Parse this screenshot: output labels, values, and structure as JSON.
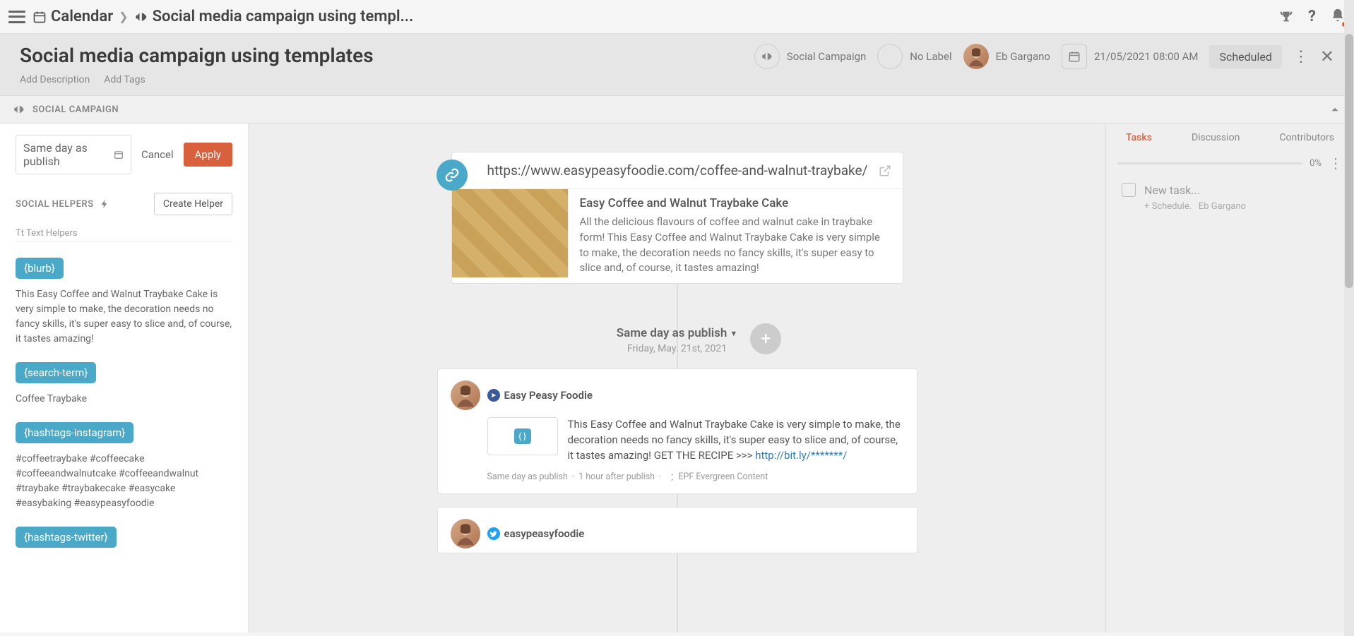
{
  "breadcrumb": {
    "root": "Calendar",
    "current": "Social media campaign using templ..."
  },
  "header": {
    "title": "Social media campaign using templates",
    "add_description": "Add Description",
    "add_tags": "Add Tags",
    "campaign_type": "Social Campaign",
    "label": "No Label",
    "owner": "Eb Gargano",
    "datetime": "21/05/2021 08:00 AM",
    "status": "Scheduled"
  },
  "section_bar": {
    "title": "SOCIAL CAMPAIGN"
  },
  "sidebar": {
    "date_placeholder": "Same day as publish",
    "cancel": "Cancel",
    "apply": "Apply",
    "helpers_title": "SOCIAL HELPERS",
    "create_helper": "Create Helper",
    "text_helpers_label": "Tt  Text Helpers",
    "helpers": [
      {
        "tag": "{blurb}",
        "text": "This Easy Coffee and Walnut Traybake Cake is very simple to make, the decoration needs no fancy skills, it's super easy to slice and, of course, it tastes amazing!"
      },
      {
        "tag": "{search-term}",
        "text": "Coffee Traybake"
      },
      {
        "tag": "{hashtags-instagram}",
        "text": "#coffeetraybake #coffeecake #coffeeandwalnutcake #coffeeandwalnut #traybake #traybakecake #easycake #easybaking #easypeasyfoodie"
      },
      {
        "tag": "{hashtags-twitter}",
        "text": ""
      }
    ]
  },
  "canvas": {
    "url": "https://www.easypeasyfoodie.com/coffee-and-walnut-traybake/",
    "url_title": "Easy Coffee and Walnut Traybake Cake",
    "url_desc": "All the delicious flavours of coffee and walnut cake in traybake form! This Easy Coffee and Walnut Traybake Cake is very simple to make, the decoration needs no fancy skills, it's super easy to slice and, of course, it tastes amazing!",
    "timeline_label": "Same day as publish",
    "timeline_date": "Friday, May. 21st, 2021",
    "posts": [
      {
        "network": "facebook",
        "handle": "Easy Peasy Foodie",
        "text": "This Easy Coffee and Walnut Traybake Cake is very simple to make, the decoration needs no fancy skills, it's super easy to slice and, of course, it tastes amazing! GET THE RECIPE >>> ",
        "link": "http://bit.ly/*******/",
        "meta_left": "Same day as publish",
        "meta_sep": "·",
        "meta_mid": "1 hour after publish",
        "meta_right": "EPF Evergreen Content"
      },
      {
        "network": "twitter",
        "handle": "easypeasyfoodie"
      }
    ]
  },
  "rightpanel": {
    "tabs": {
      "tasks": "Tasks",
      "discussion": "Discussion",
      "contributors": "Contributors"
    },
    "progress": "0%",
    "new_task": "New task...",
    "task_sub_schedule": "+ Schedule.",
    "task_sub_owner": "Eb Gargano"
  }
}
